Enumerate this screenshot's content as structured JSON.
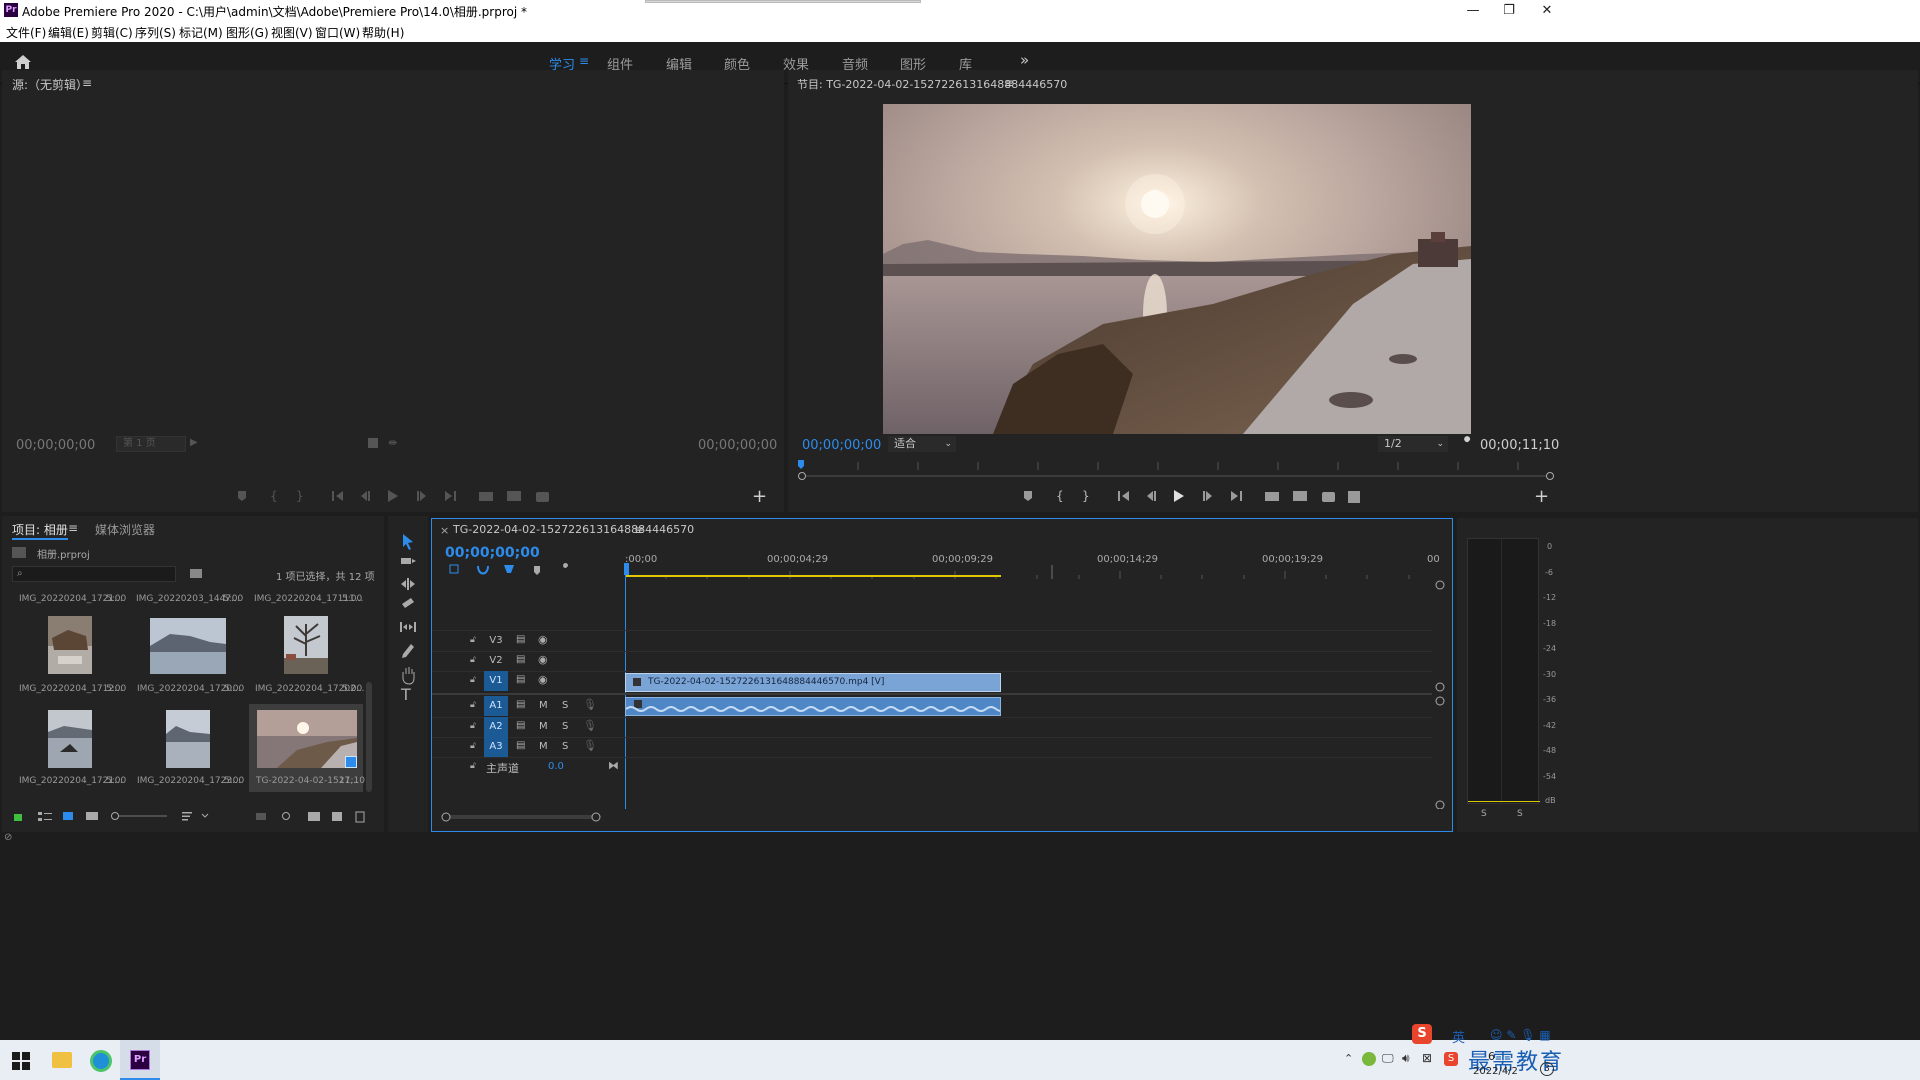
{
  "window": {
    "title": "Adobe Premiere Pro 2020 - C:\\用户\\admin\\文档\\Adobe\\Premiere Pro\\14.0\\相册.prproj *",
    "app_icon": "Pr",
    "controls": {
      "minimize": "—",
      "restore": "❐",
      "close": "✕"
    }
  },
  "menu": [
    "文件(F)",
    "编辑(E)",
    "剪辑(C)",
    "序列(S)",
    "标记(M)",
    "图形(G)",
    "视图(V)",
    "窗口(W)",
    "帮助(H)"
  ],
  "workspaces": {
    "items": [
      "学习",
      "组件",
      "编辑",
      "颜色",
      "效果",
      "音频",
      "图形",
      "库"
    ],
    "active": "学习",
    "overflow": "»"
  },
  "source_monitor": {
    "title": "源:（无剪辑）",
    "menu_glyph": "≡",
    "timecode_in": "00;00;00;00",
    "page_select": "第 1 页",
    "timecode_out": "00;00;00;00",
    "add": "+"
  },
  "program_monitor": {
    "title": "节目: TG-2022-04-02-1527226131648884446570",
    "menu_glyph": "≡",
    "timecode_current": "00;00;00;00",
    "fit_select": "适合",
    "resolution_select": "1/2",
    "timecode_duration": "00;00;11;10",
    "add": "+"
  },
  "project_panel": {
    "tabs": [
      "项目: 相册",
      "媒体浏览器"
    ],
    "active_tab": "项目: 相册",
    "menu_glyph": "≡",
    "project_file": "相册.prproj",
    "search_placeholder": "",
    "selection_info": "1 项已选择，共 12 项",
    "top_row": [
      {
        "name": "IMG_20220204_1721...",
        "duration": "5:00"
      },
      {
        "name": "IMG_20220203_1447...",
        "duration": "5:00"
      },
      {
        "name": "IMG_20220204_17111...",
        "duration": "5:00"
      }
    ],
    "items": [
      {
        "name": "IMG_20220204_1712...",
        "duration": "5:00",
        "thumb": "portrait-ruins"
      },
      {
        "name": "IMG_20220204_1720...",
        "duration": "5:00",
        "thumb": "landscape-mountain-lake"
      },
      {
        "name": "IMG_20220204_17202...",
        "duration": "5:00",
        "thumb": "portrait-tree"
      },
      {
        "name": "IMG_20220204_1721...",
        "duration": "5:00",
        "thumb": "portrait-boat"
      },
      {
        "name": "IMG_20220204_1723...",
        "duration": "5:00",
        "thumb": "portrait-mountain-lake"
      },
      {
        "name": "TG-2022-04-02-1527...",
        "duration": "11;10",
        "thumb": "sunset-river",
        "selected": true
      }
    ]
  },
  "timeline": {
    "sequence_tab": "TG-2022-04-02-1527226131648884446570",
    "close_glyph": "×",
    "menu_glyph": "≡",
    "timecode": "00;00;00;00",
    "ruler_labels": [
      ":00;00",
      "00;00;04;29",
      "00;00;09;29",
      "00;00;14;29",
      "00;00;19;29",
      "00"
    ],
    "video_tracks": [
      "V3",
      "V2",
      "V1"
    ],
    "audio_tracks": [
      "A1",
      "A2",
      "A3"
    ],
    "audio_buttons": {
      "mute": "M",
      "solo": "S"
    },
    "master_label": "主声道",
    "master_value": "0.0",
    "video_clip_label": "TG-2022-04-02-1527226131648884446570.mp4 [V]",
    "clip_end_seconds": 11.33,
    "ruler_span_seconds": 24.5
  },
  "audio_meter": {
    "scale": [
      "0",
      "-6",
      "-12",
      "-18",
      "-24",
      "-30",
      "-36",
      "-42",
      "-48",
      "-54",
      "dB"
    ],
    "solo_buttons": [
      "S",
      "S"
    ]
  },
  "tools": [
    "selection-tool",
    "track-select-tool",
    "ripple-edit-tool",
    "razor-tool",
    "slip-tool",
    "pen-tool",
    "hand-tool",
    "type-tool"
  ],
  "taskbar": {
    "ime": "英",
    "watermark": "最需教育",
    "date": "2022/4/2",
    "notification_count": "3",
    "time_partial": "6"
  },
  "colors": {
    "accent": "#2d8ceb",
    "video_clip": "#7aa3d6",
    "audio_clip": "#4f86c6",
    "work_area": "#e3c800",
    "panel": "#232323",
    "background": "#1d1d1d"
  }
}
